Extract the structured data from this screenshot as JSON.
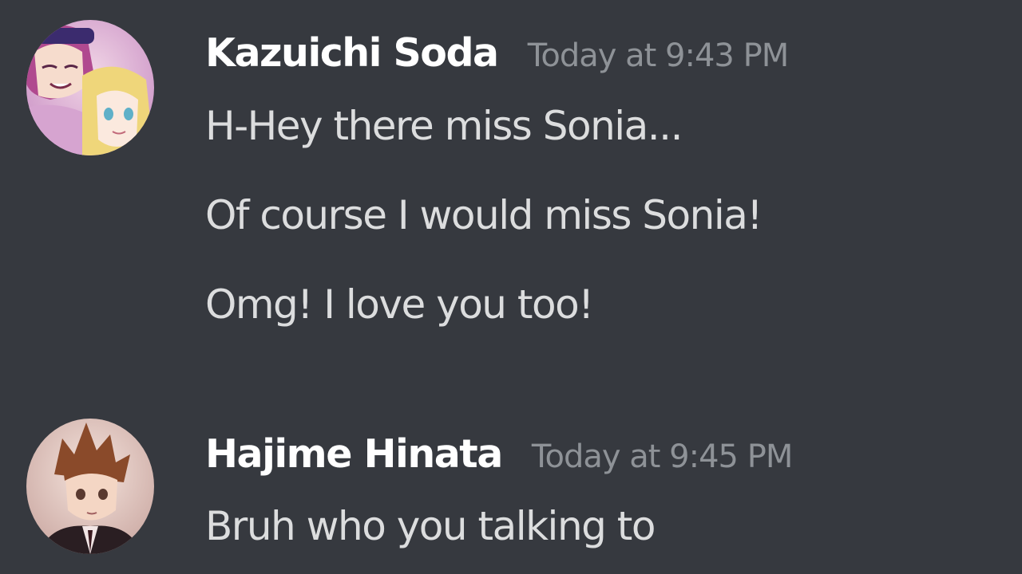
{
  "messages": [
    {
      "username": "Kazuichi Soda",
      "timestamp": "Today at 9:43 PM",
      "lines": [
        "H-Hey there miss Sonia...",
        "Of course I would miss Sonia!",
        "Omg! I love you too!"
      ],
      "avatar_icon": "anime-character-avatar-pink-blonde"
    },
    {
      "username": "Hajime Hinata",
      "timestamp": "Today at 9:45 PM",
      "lines": [
        "Bruh who you talking to"
      ],
      "avatar_icon": "anime-character-avatar-brown-hair"
    }
  ],
  "colors": {
    "background": "#36393f",
    "username": "#ffffff",
    "timestamp": "#8e9297",
    "message_text": "#dcddde"
  }
}
